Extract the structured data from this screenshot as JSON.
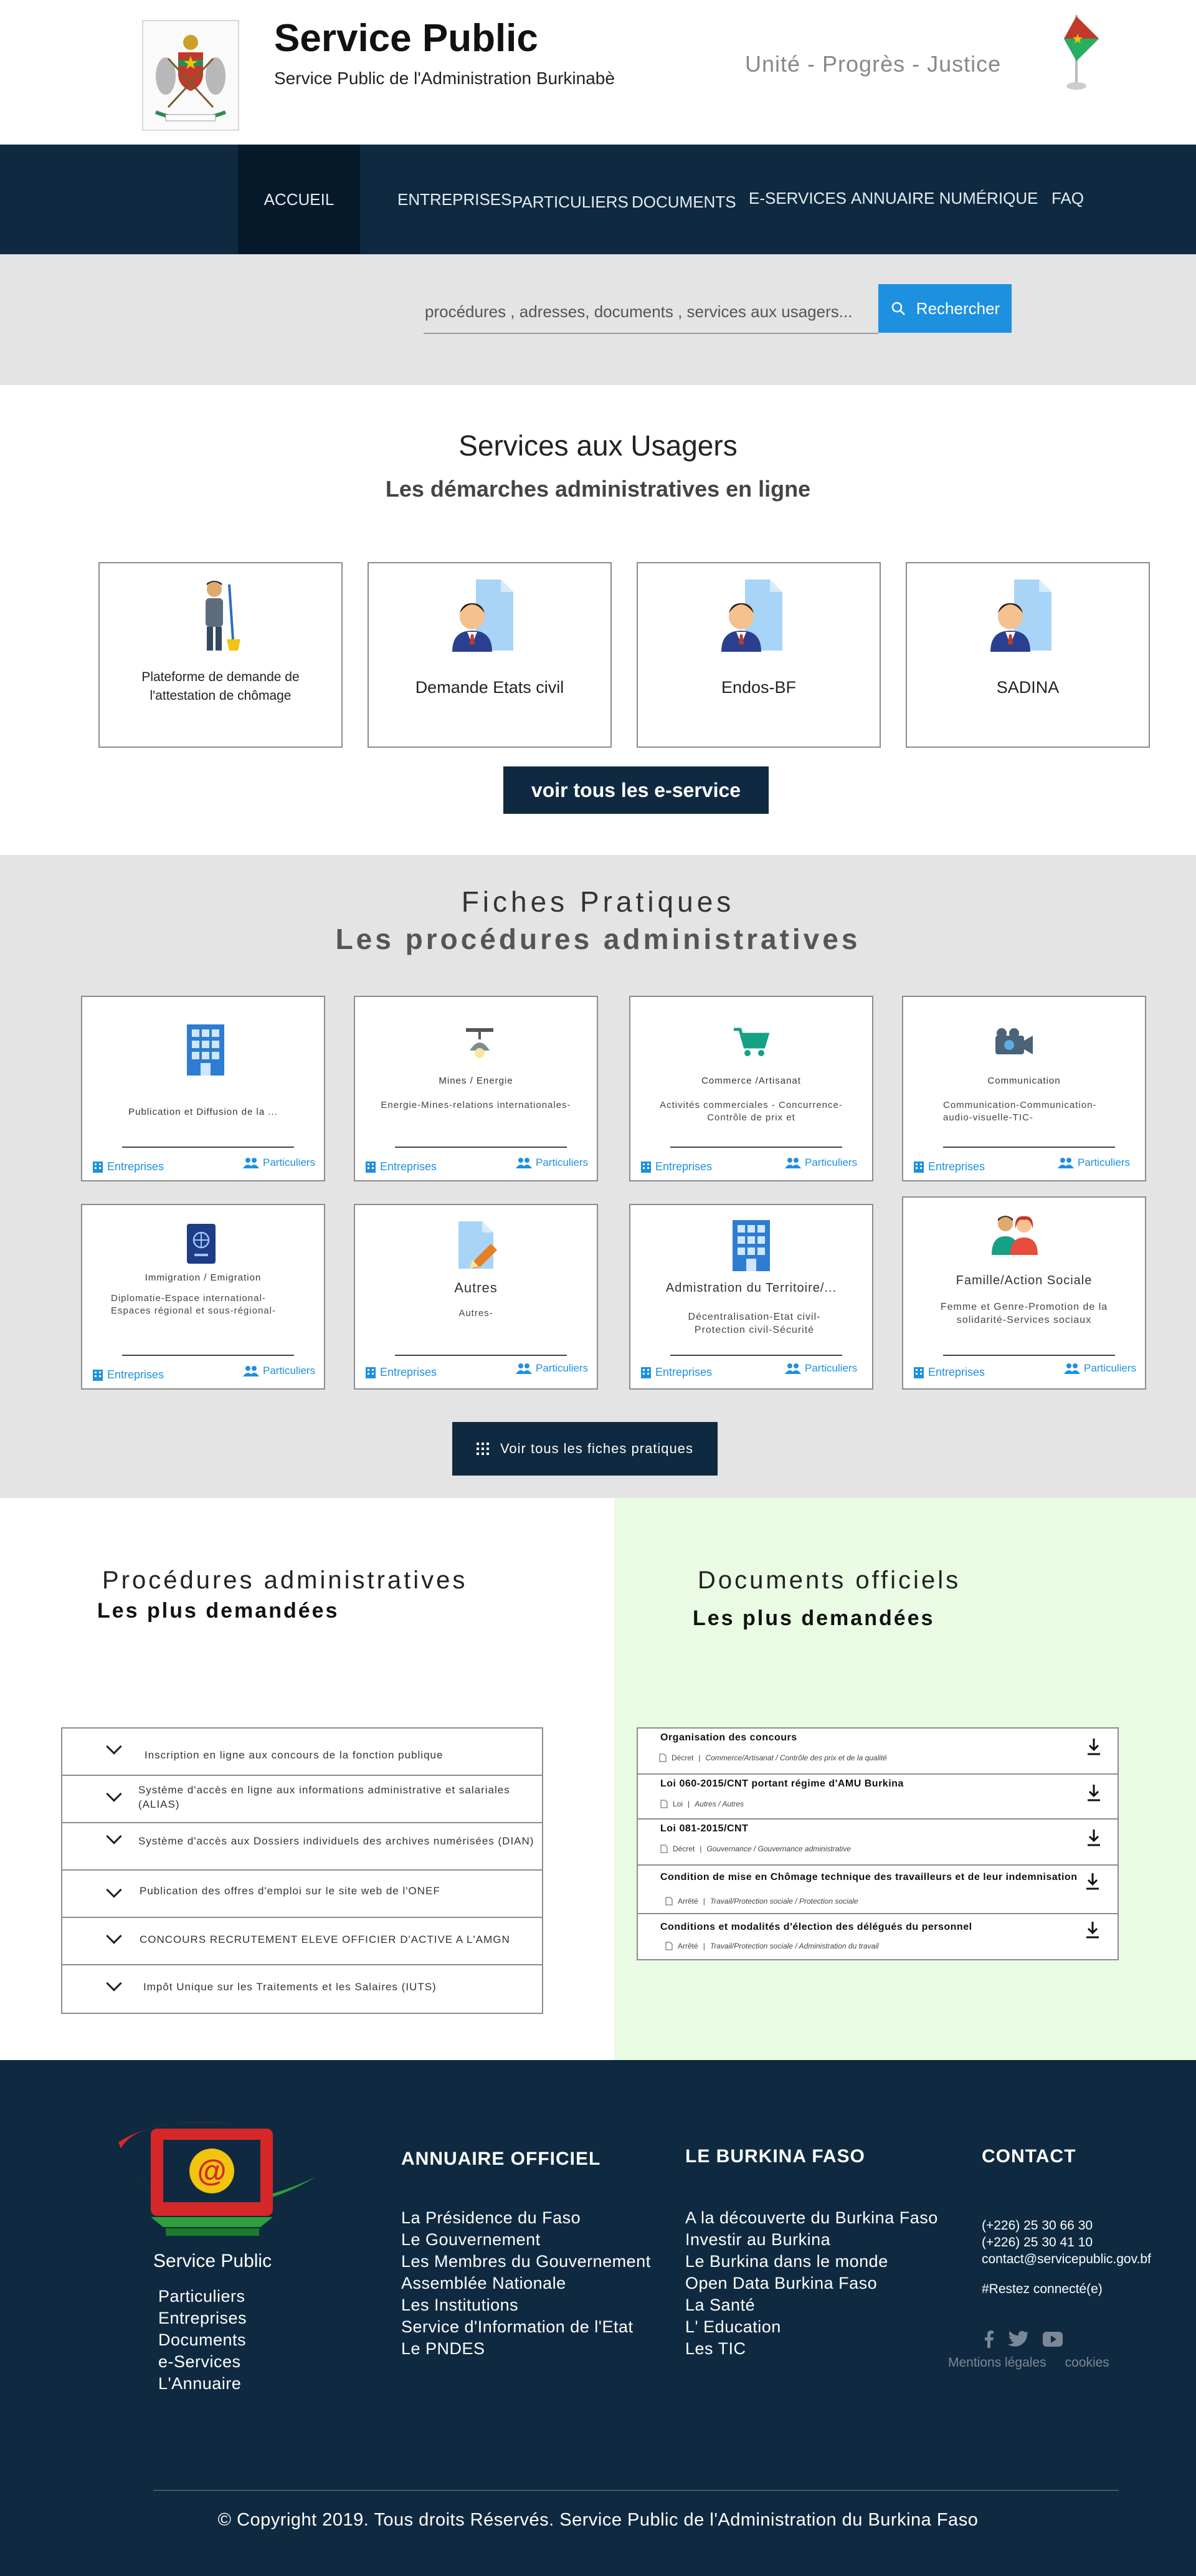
{
  "header": {
    "title": "Service Public",
    "subtitle": "Service Public de l'Administration Burkinabè",
    "motto": "Unité - Progrès - Justice"
  },
  "nav": {
    "items": [
      "ACCUEIL",
      "ENTREPRISES",
      "PARTICULIERS",
      "DOCUMENTS",
      "E-SERVICES",
      "ANNUAIRE  NUMÉRIQUE",
      "FAQ"
    ],
    "active": "ACCUEIL"
  },
  "search": {
    "placeholder": "procédures , adresses, documents , services aux usagers...",
    "button_label": "Rechercher"
  },
  "services": {
    "title": "Services aux Usagers",
    "subtitle": "Les démarches administratives en ligne",
    "cards": [
      {
        "label": "Plateforme de demande de l'attestation de chômage",
        "icon": "worker-icon"
      },
      {
        "label": "Demande  Etats civil",
        "icon": "user-document-icon"
      },
      {
        "label": "Endos-BF",
        "icon": "user-document-icon"
      },
      {
        "label": "SADINA",
        "icon": "user-document-icon"
      }
    ],
    "button_label": "voir tous les e-service"
  },
  "fiches": {
    "title": "Fiches Pratiques",
    "subtitle": "Les procédures administratives",
    "link_entreprises": "Entreprises",
    "link_particuliers": "Particuliers",
    "cards": [
      {
        "title": "Publication et Diffusion de la ...",
        "desc": "",
        "icon": "building-icon"
      },
      {
        "title": "Mines / Energie",
        "desc": "Energie-Mines-relations internationales-",
        "icon": "lamp-icon"
      },
      {
        "title": "Commerce /Artisanat",
        "desc": "Activités commerciales - Concurrence-Contrôle de prix et",
        "icon": "cart-icon"
      },
      {
        "title": "Communication",
        "desc": "Communication-Communication-audio-visuelle-TIC-",
        "icon": "camera-icon"
      },
      {
        "title": "Immigration / Emigration",
        "desc": "Diplomatie-Espace international-Espaces régional et sous-régional-",
        "icon": "passport-icon"
      },
      {
        "title": "Autres",
        "desc": "Autres-",
        "icon": "document-pen-icon"
      },
      {
        "title": "Admistration du Territoire/...",
        "desc": "Décentralisation-Etat civil-Protection civil-Sécurité",
        "icon": "building-icon"
      },
      {
        "title": "Famille/Action Sociale",
        "desc": "Femme et Genre-Promotion de la solidarité-Services sociaux",
        "icon": "family-icon"
      }
    ],
    "button_label": "Voir tous les fiches pratiques"
  },
  "procedures": {
    "title": "Procédures administratives",
    "subtitle": "Les plus demandées",
    "items": [
      "Inscription en ligne aux concours de la fonction publique",
      "Système d'accès en ligne aux informations administrative et salariales (ALIAS)",
      "Système d'accès aux Dossiers individuels des archives numérisées (DIAN)",
      "Publication des offres d'emploi sur le site web de l'ONEF",
      "CONCOURS RECRUTEMENT ELEVE OFFICIER D'ACTIVE A L'AMGN",
      "Impôt Unique sur les Traitements et les Salaires (IUTS)"
    ]
  },
  "documents": {
    "title": "Documents officiels",
    "subtitle": "Les plus demandées",
    "items": [
      {
        "title": "Organisation des concours",
        "type": "Décret",
        "tags": "Commerce/Artisanat / Contrôle des prix et de la qualité"
      },
      {
        "title": "Loi 060-2015/CNT portant régime d'AMU Burkina",
        "type": "Loi",
        "tags": "Autres / Autres"
      },
      {
        "title": "Loi 081-2015/CNT",
        "type": "Décret",
        "tags": "Gouvernance / Gouvernance administrative"
      },
      {
        "title": "Condition de mise en Chômage technique des travailleurs et de leur indemnisation",
        "type": "Arrêté",
        "tags": "Travail/Protection sociale / Protection sociale"
      },
      {
        "title": "Conditions et modalités d'élection des délégués du personnel",
        "type": "Arrêté",
        "tags": "Travail/Protection sociale / Administration du travail"
      }
    ]
  },
  "footer": {
    "brand": "Service Public",
    "brand_links": [
      "Particuliers",
      "Entreprises",
      "Documents",
      "e-Services",
      "L'Annuaire"
    ],
    "annuaire_title": "ANNUAIRE OFFICIEL",
    "annuaire_links": [
      "La Présidence du Faso",
      "Le Gouvernement",
      "Les Membres du Gouvernement",
      "Assemblée Nationale",
      "Les Institutions",
      "Service d'Information de l'Etat",
      "Le PNDES"
    ],
    "burkina_title": "LE BURKINA FASO",
    "burkina_links": [
      "A la découverte du Burkina Faso",
      "Investir au Burkina",
      "Le Burkina dans le monde",
      "Open Data Burkina Faso",
      "La Santé",
      "L' Education",
      "Les TIC"
    ],
    "contact_title": "CONTACT",
    "phone1": "(+226) 25 30 66 30",
    "phone2": "(+226) 25 30 41 10",
    "email": "contact@servicepublic.gov.bf",
    "hashtag": "#Restez connecté(e)",
    "mentions": "Mentions légales",
    "cookies": "cookies",
    "copyright": "© Copyright 2019. Tous droits Réservés. Service Public de l'Administration du Burkina Faso"
  },
  "colors": {
    "navy": "#0f2a40",
    "accent_blue": "#1e90e0",
    "band_gray": "#e4e4e4",
    "docs_green": "#e9fbe3"
  }
}
